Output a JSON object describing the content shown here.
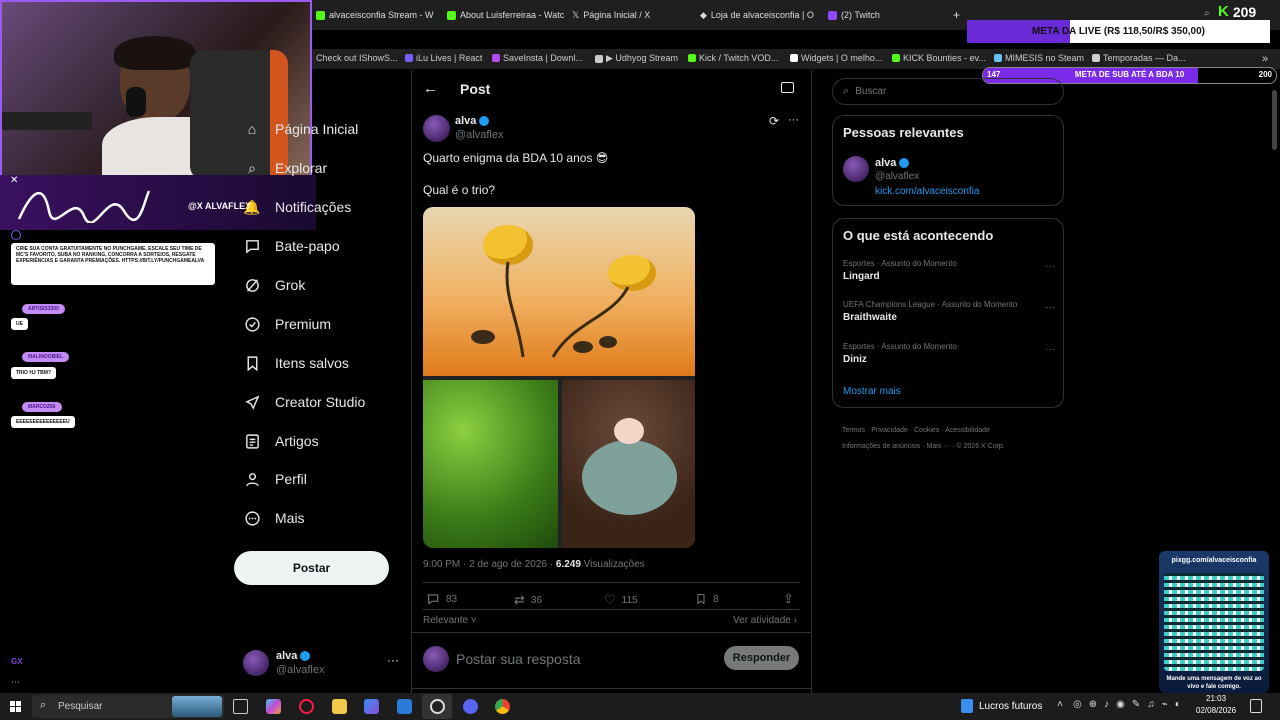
{
  "browser": {
    "tabs": [
      {
        "label": "alvaceisconfia Stream - W",
        "color": "#53fc18"
      },
      {
        "label": "About Luisferreiraa - Watc",
        "color": "#53fc18"
      },
      {
        "label": "Página Inicial / X",
        "color": "#ffffff"
      },
      {
        "label": "Loja de alvaceisconfia | O",
        "color": "#ffffff"
      },
      {
        "label": "(2) Twitch",
        "color": "#9146ff"
      }
    ],
    "bookmarks": [
      {
        "label": "Check out IShowS...",
        "color": ""
      },
      {
        "label": "iLu Lives | React",
        "color": "#7b5cff"
      },
      {
        "label": "SaveInsta | Downl...",
        "color": "#b04cf0"
      },
      {
        "label": "▶ Udhyog Stream",
        "color": "#cccccc"
      },
      {
        "label": "Kick / Twitch VOD...",
        "color": "#53fc18"
      },
      {
        "label": "Widgets | O melho...",
        "color": "#ffffff"
      },
      {
        "label": "KICK Bounties - ev...",
        "color": "#53fc18"
      },
      {
        "label": "MIMESIS no Steam",
        "color": "#66c0f4"
      },
      {
        "label": "Temporadas — Da...",
        "color": "#cccccc"
      }
    ]
  },
  "overlay": {
    "kick_count": "209",
    "meta_live": "META DA LIVE (R$ 118,50/R$ 350,00)",
    "meta_live_progress": 0.339,
    "sub_left": "147",
    "sub_goal": "META DE SUB ATÉ A BDA 10",
    "sub_right": "200",
    "sub_progress": 0.735,
    "handle": "@X ALVAFLEX",
    "promo": "CRIE SUA CONTA GRATUITAMENTE NO PUNCHGAME, ESCALE SEU TIME DE MC'S FAVORITO, SUBA NO RANKING, CONCORRA A SORTEIOS, RESGATE EXPERIÊNCIAS E GARANTA PREMIAÇÕES. HTTPS://BIT.LY/PUNCHGAMEALVA",
    "chat": [
      {
        "name": "ARTISIS3300",
        "msg": "UE"
      },
      {
        "name": "MALINOOBIEL",
        "msg": "TRIO HJ TBM?"
      },
      {
        "name": "MARCOZ66",
        "msg": "EEEEEEEEEEEEEEEU"
      }
    ],
    "pix_url": "pixgg.com/alvaceisconfia",
    "pix_caption": "Mande uma mensagem de voz ao vivo e fale comigo."
  },
  "nav": {
    "items": [
      {
        "label": "Página Inicial",
        "icon": "home-icon"
      },
      {
        "label": "Explorar",
        "icon": "search-icon"
      },
      {
        "label": "Notificações",
        "icon": "bell-icon"
      },
      {
        "label": "Bate-papo",
        "icon": "chat-icon"
      },
      {
        "label": "Grok",
        "icon": "grok-icon"
      },
      {
        "label": "Premium",
        "icon": "verified-icon"
      },
      {
        "label": "Itens salvos",
        "icon": "bookmark-icon"
      },
      {
        "label": "Creator Studio",
        "icon": "rocket-icon"
      },
      {
        "label": "Artigos",
        "icon": "article-icon"
      },
      {
        "label": "Perfil",
        "icon": "person-icon"
      },
      {
        "label": "Mais",
        "icon": "more-icon"
      }
    ],
    "post_button": "Postar",
    "account": {
      "name": "alva",
      "handle": "@alvaflex"
    }
  },
  "post": {
    "header": "Post",
    "author": "alva",
    "handle": "@alvaflex",
    "line1": "Quarto enigma da BDA 10 anos 😎",
    "line2": "Qual é o trio?",
    "timestamp": "9:00 PM · 2 de ago de 2026 · ",
    "views_count": "6.249",
    "views_label": " Visualizações",
    "replies": "83",
    "reposts": "36",
    "likes": "115",
    "bookmarks": "8",
    "sort_label": "Relevante",
    "activity_label": "Ver atividade",
    "reply_placeholder": "Postar sua resposta",
    "reply_button": "Responder"
  },
  "sidebar": {
    "search_placeholder": "Buscar",
    "relevant_title": "Pessoas relevantes",
    "relevant": {
      "name": "alva",
      "handle": "@alvaflex",
      "link": "kick.com/alvaceisconfia"
    },
    "trends_title": "O que está acontecendo",
    "trends": [
      {
        "meta": "Esportes · Assunto do Momento",
        "topic": "Lingard"
      },
      {
        "meta": "UEFA Champions League · Assunto do Momento",
        "topic": "Braithwaite"
      },
      {
        "meta": "Esportes · Assunto do Momento",
        "topic": "Diniz"
      }
    ],
    "show_more": "Mostrar mais",
    "footer": [
      "Termos",
      "Privacidade",
      "Cookies",
      "Acessibilidade",
      "Informações de anúncios",
      "Mais ···",
      "© 2026 X Corp."
    ]
  },
  "taskbar": {
    "search_placeholder": "Pesquisar",
    "stocks_label": "Lucros futuros",
    "date": "02/08/2026",
    "time": "21:03"
  }
}
